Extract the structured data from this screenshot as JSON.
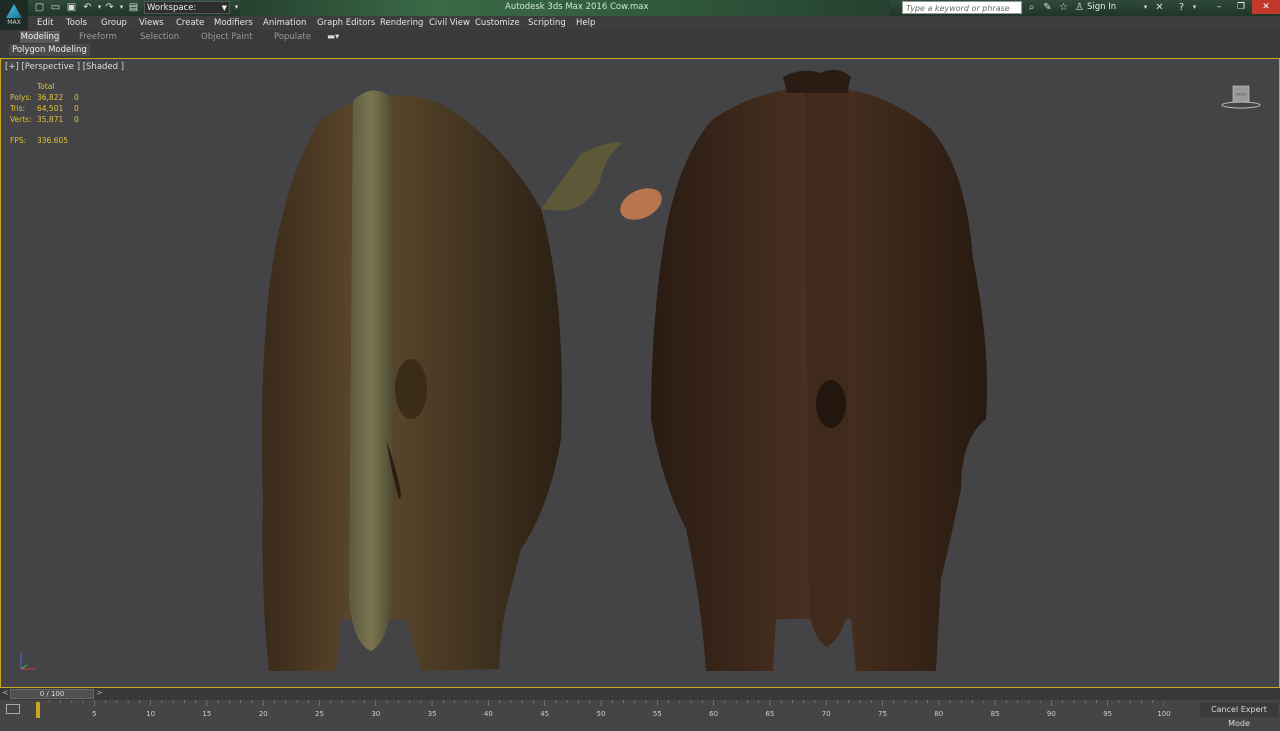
{
  "window": {
    "app_title": "Autodesk 3ds Max 2016    Cow.max",
    "workspace": "Workspace: Default",
    "search_placeholder": "Type a keyword or phrase",
    "sign_in": "Sign In",
    "logo_label": "MAX"
  },
  "menu": [
    "Edit",
    "Tools",
    "Group",
    "Views",
    "Create",
    "Modifiers",
    "Animation",
    "Graph Editors",
    "Rendering",
    "Civil View",
    "Customize",
    "Scripting",
    "Help"
  ],
  "ribbon": {
    "tabs": [
      "Modeling",
      "Freeform",
      "Selection",
      "Object Paint",
      "Populate"
    ],
    "active_tab": "Modeling",
    "panel": "Polygon Modeling"
  },
  "viewport": {
    "label": "[+] [Perspective ] [Shaded ]",
    "stats_header": "Total",
    "stats": [
      {
        "label": "Polys:",
        "total": "36,822",
        "sel": "0"
      },
      {
        "label": "Tris:",
        "total": "64,501",
        "sel": "0"
      },
      {
        "label": "Verts:",
        "total": "35,871",
        "sel": "0"
      }
    ],
    "fps_label": "FPS:",
    "fps_value": "336.605",
    "viewcube_label": "BACK"
  },
  "timeline": {
    "frame_display": "0 / 100",
    "prev": "<",
    "next": ">",
    "tick_labels": [
      "5",
      "10",
      "15",
      "20",
      "25",
      "30",
      "35",
      "40",
      "45",
      "50",
      "55",
      "60",
      "65",
      "70",
      "75",
      "80",
      "85",
      "90",
      "95",
      "100"
    ],
    "cancel_expert": "Cancel Expert Mode"
  },
  "colors": {
    "accent": "#c9a81f",
    "stats_text": "#e2c23a",
    "viewport_bg": "#444446"
  }
}
